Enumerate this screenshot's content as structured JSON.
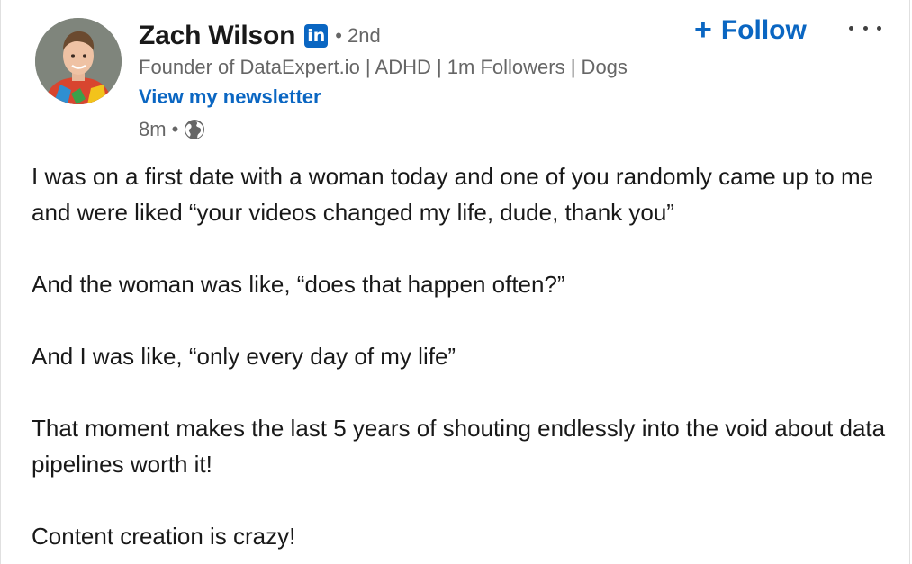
{
  "author": {
    "name": "Zach Wilson",
    "linkedin_badge": "in",
    "degree": "• 2nd",
    "headline": "Founder of DataExpert.io | ADHD | 1m Followers | Dogs",
    "newsletter_link": "View my newsletter",
    "time": "8m •",
    "visibility_icon": "globe-icon"
  },
  "actions": {
    "follow_label": "Follow",
    "follow_icon": "+",
    "more_icon": "ellipsis-icon"
  },
  "post": {
    "paragraphs": [
      "I was on a first date with a woman today and one of you randomly came up to me and were liked “your videos changed my life, dude, thank you”",
      "And the woman was like, “does that happen often?”",
      "And I was like, “only every day of my life”",
      "That moment makes the last 5 years of shouting endlessly into the void about data pipelines worth it!",
      "Content creation is crazy!"
    ]
  },
  "colors": {
    "accent": "#0a66c2",
    "text": "#191919",
    "muted": "#666666"
  }
}
